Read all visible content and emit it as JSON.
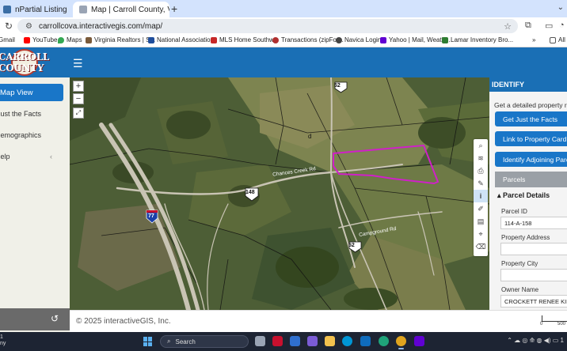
{
  "browser": {
    "tabs": [
      {
        "title": "nPartial Listing",
        "active": false
      },
      {
        "title": "Map | Carroll County, VA",
        "active": true
      }
    ],
    "new_tab": "+",
    "tab_menu": "⌄",
    "url": "carrollcova.interactivegis.com/map/",
    "bookmarks": [
      {
        "label": "Gmail",
        "color": "#ffffff"
      },
      {
        "label": "YouTube",
        "color": "#ff0000"
      },
      {
        "label": "Maps",
        "color": "#34a853"
      },
      {
        "label": "Virginia Realtors | S...",
        "color": "#7a5a3a"
      },
      {
        "label": "National Associatio...",
        "color": "#1f4e9c"
      },
      {
        "label": "MLS Home Southw...",
        "color": "#c62828"
      },
      {
        "label": "Transactions (zipFor...",
        "color": "#b03030"
      },
      {
        "label": "Navica Login",
        "color": "#444444"
      },
      {
        "label": "Yahoo | Mail, Weath...",
        "color": "#6001d2"
      },
      {
        "label": "Lamar Inventory Bro...",
        "color": "#2e7d32"
      }
    ],
    "bookmarks_more": "»",
    "all_bookmarks": "All"
  },
  "app": {
    "logo_text": "CARROLL COUNTY",
    "sidebar": [
      {
        "label": "Map View",
        "active": true,
        "chevron": ""
      },
      {
        "label": "Just the Facts",
        "active": false,
        "chevron": ""
      },
      {
        "label": "Demographics",
        "active": false,
        "chevron": ""
      },
      {
        "label": "Help",
        "active": false,
        "chevron": "‹"
      }
    ],
    "copyright": "© 2025 interactiveGIS, Inc.",
    "scale": {
      "start": "0",
      "end": "500"
    },
    "map_labels": {
      "route_52": "52",
      "route_148": "148",
      "interstate_77": "77",
      "chances_creek_rd": "Chances Creek Rd",
      "campground_rd": "Campground Rd",
      "parcel_letter": "d"
    }
  },
  "identify": {
    "title": "IDENTIFY",
    "intro": "Get a detailed property report",
    "buttons": [
      {
        "label": "Get Just the Facts"
      },
      {
        "label": "Link to Property Card"
      },
      {
        "label": "Identify Adjoining Parcels"
      }
    ],
    "parcels_tab": "Parcels",
    "section": "Parcel Details",
    "fields": [
      {
        "label": "Parcel ID",
        "value": "114-A-158"
      },
      {
        "label": "Property Address",
        "value": ""
      },
      {
        "label": "Property City",
        "value": ""
      },
      {
        "label": "Owner Name",
        "value": "CROCKETT RENEE KIMBERLY"
      }
    ]
  },
  "taskbar": {
    "weather": [
      "1",
      "ny"
    ],
    "search_placeholder": "Search",
    "apps": [
      {
        "name": "task-view",
        "color": "#9aa4b4"
      },
      {
        "name": "mcafee",
        "color": "#c8102e"
      },
      {
        "name": "app-blue",
        "color": "#2f6fcf"
      },
      {
        "name": "copilot",
        "color": "#7b5cd6"
      },
      {
        "name": "file-explorer",
        "color": "#f2c14e"
      },
      {
        "name": "outlook",
        "color": "#0f6cbd"
      },
      {
        "name": "hp",
        "color": "#0096d6"
      },
      {
        "name": "edge",
        "color": "#1fa37a"
      },
      {
        "name": "chrome",
        "color": "#e0a41e"
      },
      {
        "name": "word",
        "color": "#2b579a"
      },
      {
        "name": "yahoo",
        "color": "#6001d2"
      }
    ],
    "tray": "⌃  ☁  ◎  ⟰  ◍  ◀)  ▭  1"
  },
  "colors": {
    "brand_blue": "#1a6fb5",
    "button_blue": "#1976c8",
    "parcel_outline": "#d020c8",
    "map_base": "#50623a"
  }
}
